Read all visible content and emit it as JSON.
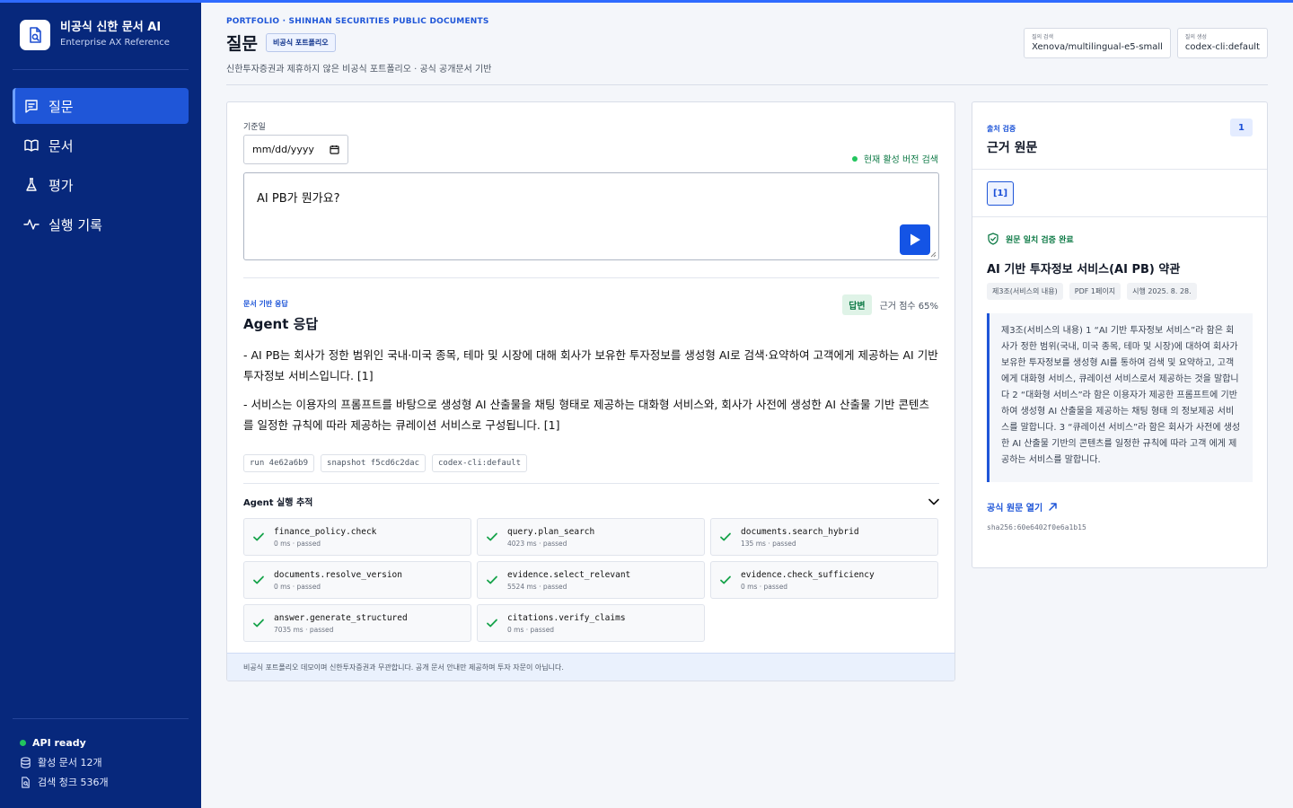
{
  "sidebar": {
    "brand_title": "비공식 신한 문서 AI",
    "brand_subtitle": "Enterprise AX Reference",
    "nav": [
      {
        "label": "질문",
        "icon": "chat-icon",
        "active": true
      },
      {
        "label": "문서",
        "icon": "book-icon",
        "active": false
      },
      {
        "label": "평가",
        "icon": "flask-icon",
        "active": false
      },
      {
        "label": "실행 기록",
        "icon": "activity-icon",
        "active": false
      }
    ],
    "status": {
      "api": "API ready",
      "docs": "활성 문서 12개",
      "chunks": "검색 청크 536개"
    }
  },
  "header": {
    "eyebrow": "PORTFOLIO · SHINHAN SECURITIES PUBLIC DOCUMENTS",
    "title": "질문",
    "badge": "비공식 포트폴리오",
    "description": "신한투자증권과 제휴하지 않은 비공식 포트폴리오 · 공식 공개문서 기반",
    "chips": [
      {
        "label": "질의 검색",
        "value": "Xenova/multilingual-e5-small"
      },
      {
        "label": "질의 생성",
        "value": "codex-cli:default"
      }
    ]
  },
  "query": {
    "date_label": "기준일",
    "date_placeholder": "mm/dd/yyyy",
    "active_search": "현재 활성 버전 검색",
    "text": "AI PB가 뭔가요?"
  },
  "answer": {
    "eyebrow": "문서 기반 응답",
    "title": "Agent 응답",
    "badge": "답변",
    "score": "근거 점수 65%",
    "paragraphs": [
      "- AI PB는 회사가 정한 범위인 국내·미국 종목, 테마 및 시장에 대해 회사가 보유한 투자정보를 생성형 AI로 검색·요약하여 고객에게 제공하는 AI 기반 투자정보 서비스입니다. [1]",
      "- 서비스는 이용자의 프롬프트를 바탕으로 생성형 AI 산출물을 채팅 형태로 제공하는 대화형 서비스와, 회사가 사전에 생성한 AI 산출물 기반 콘텐츠를 일정한 규칙에 따라 제공하는 큐레이션 서비스로 구성됩니다. [1]"
    ],
    "tags": [
      "run 4e62a6b9",
      "snapshot f5cd6c2dac",
      "codex-cli:default"
    ]
  },
  "trace": {
    "title": "Agent 실행 추적",
    "steps": [
      {
        "name": "finance_policy.check",
        "meta": "0 ms · passed"
      },
      {
        "name": "query.plan_search",
        "meta": "4023 ms · passed"
      },
      {
        "name": "documents.search_hybrid",
        "meta": "135 ms · passed"
      },
      {
        "name": "documents.resolve_version",
        "meta": "0 ms · passed"
      },
      {
        "name": "evidence.select_relevant",
        "meta": "5524 ms · passed"
      },
      {
        "name": "evidence.check_sufficiency",
        "meta": "0 ms · passed"
      },
      {
        "name": "answer.generate_structured",
        "meta": "7035 ms · passed"
      },
      {
        "name": "citations.verify_claims",
        "meta": "0 ms · passed"
      }
    ]
  },
  "disclaimer": "비공식 포트폴리오 데모이며 신한투자증권과 무관합니다. 공개 문서 안내만 제공하며 투자 자문이 아닙니다.",
  "evidence": {
    "eyebrow": "출처 검증",
    "title": "근거 원문",
    "count": "1",
    "citation": "[1]",
    "verified": "원문 일치 검증 완료",
    "doc_title": "AI 기반 투자정보 서비스(AI PB) 약관",
    "doc_tags": [
      "제3조(서비스의 내용)",
      "PDF 1페이지",
      "시행 2025. 8. 28."
    ],
    "quote": "제3조(서비스의 내용) 1 “AI 기반 투자정보 서비스”라 함은 회사가 정한 범위(국내, 미국 종목, 테마 및 시장)에 대하여 회사가 보유한 투자정보를 생성형 AI를 통하여 검색 및 요약하고, 고객에게 대화형 서비스, 큐레이션 서비스로서 제공하는 것을 말합니다 2 “대화형 서비스”라 함은 이용자가 제공한 프롬프트에 기반하여 생성형 AI 산출물을 제공하는 채팅 형태 의 정보제공 서비스를 말합니다. 3 “큐레이션 서비스”라 함은 회사가 사전에 생성한 AI 산출물 기반의 콘텐츠를 일정한 규칙에 따라 고객 에게 제공하는 서비스를 말합니다.",
    "open_link": "공식 원문 열기",
    "hash": "sha256:60e6402f0e6a1b15"
  },
  "colors": {
    "sidebar": "#07287c",
    "accent": "#1f56d8",
    "success": "#0e7a46"
  }
}
